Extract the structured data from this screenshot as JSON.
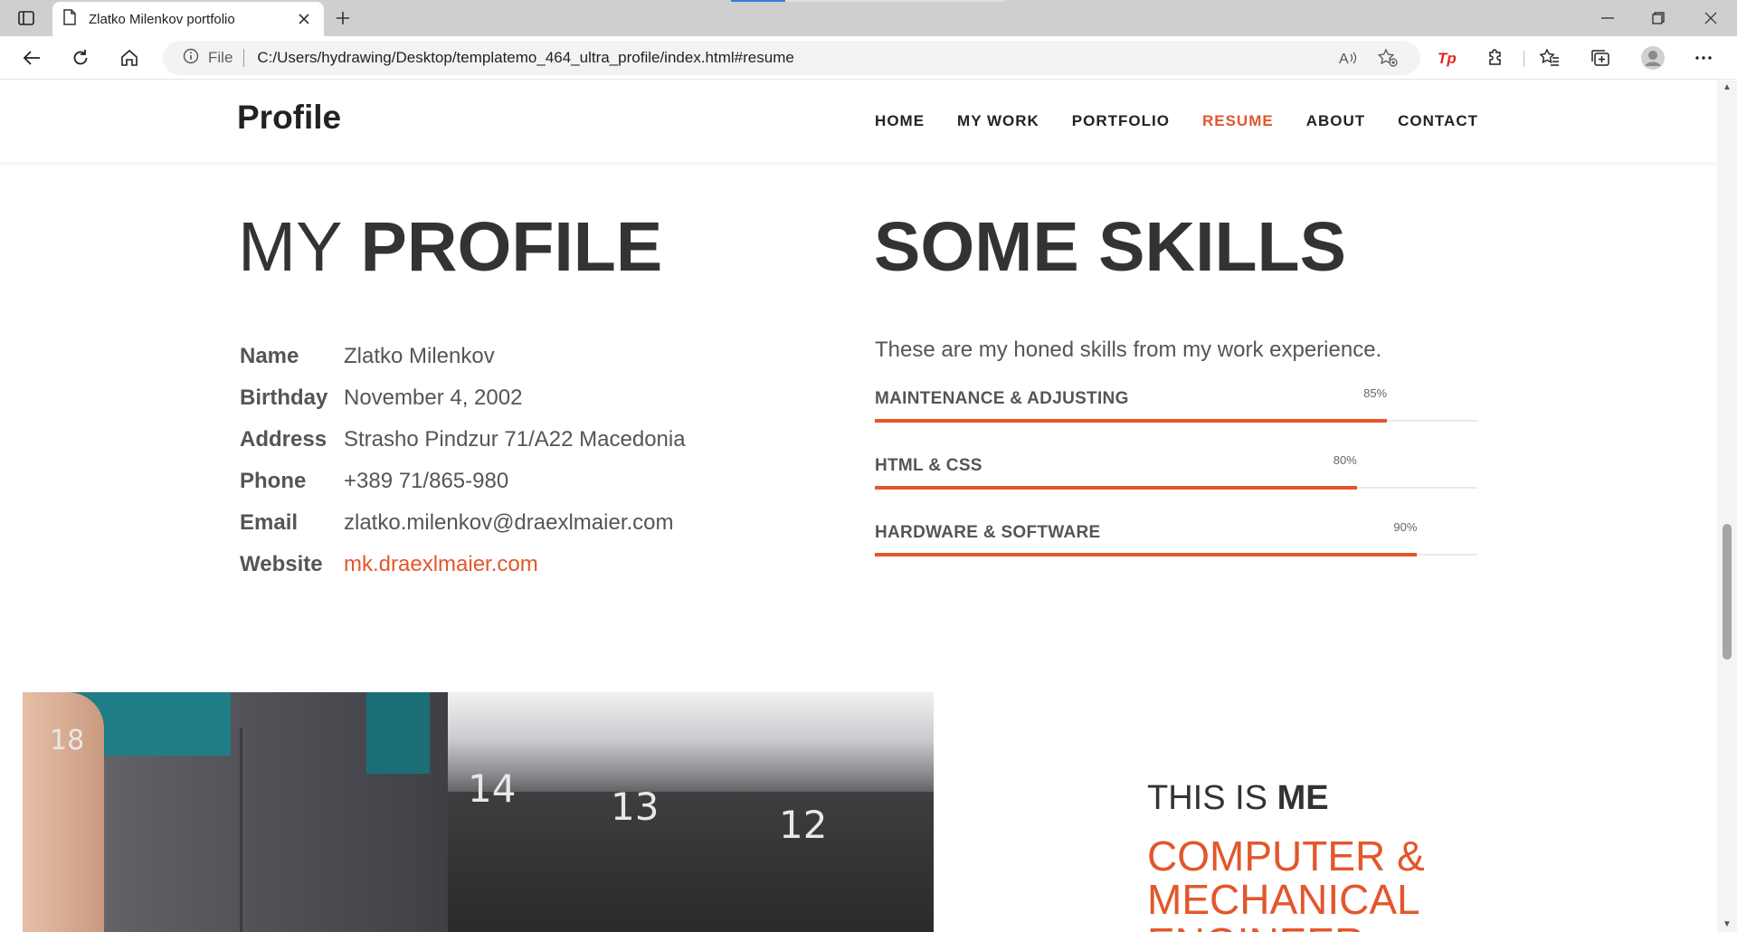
{
  "browser": {
    "tab_title": "Zlatko Milenkov portfolio",
    "file_label": "File",
    "url": "C:/Users/hydrawing/Desktop/templatemo_464_ultra_profile/index.html#resume",
    "accent": "#e2572b"
  },
  "site": {
    "brand": "Profile",
    "nav": [
      {
        "label": "HOME"
      },
      {
        "label": "MY WORK"
      },
      {
        "label": "PORTFOLIO"
      },
      {
        "label": "RESUME",
        "active": true
      },
      {
        "label": "ABOUT"
      },
      {
        "label": "CONTACT"
      }
    ]
  },
  "profile": {
    "heading_light": "MY ",
    "heading_bold": "PROFILE",
    "fields": [
      {
        "key": "Name",
        "value": "Zlatko Milenkov"
      },
      {
        "key": "Birthday",
        "value": "November 4, 2002"
      },
      {
        "key": "Address",
        "value": "Strasho Pindzur 71/A22 Macedonia"
      },
      {
        "key": "Phone",
        "value": "+389 71/865-980"
      },
      {
        "key": "Email",
        "value": "zlatko.milenkov@draexlmaier.com"
      },
      {
        "key": "Website",
        "value": "mk.draexlmaier.com"
      }
    ]
  },
  "skills": {
    "heading_bold": "SOME",
    "heading_light": " SKILLS",
    "intro": "These are my honed skills from my work experience.",
    "items": [
      {
        "label": "MAINTENANCE & ADJUSTING",
        "percent_text": "85%",
        "percent": 85
      },
      {
        "label": "HTML & CSS",
        "percent_text": "80%",
        "percent": 80
      },
      {
        "label": "HARDWARE & SOFTWARE",
        "percent_text": "90%",
        "percent": 90
      }
    ]
  },
  "photo": {
    "numbers": [
      "18",
      "14",
      "13",
      "12"
    ]
  },
  "about": {
    "title_light": "THIS IS ",
    "title_bold": "ME",
    "role_line1": "COMPUTER &",
    "role_line2": "MECHANICAL",
    "role_line3": "ENGINEER"
  }
}
